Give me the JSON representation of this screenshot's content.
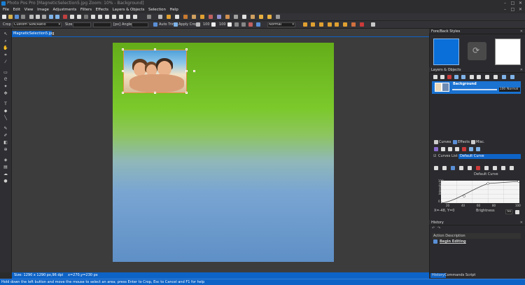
{
  "window": {
    "title": "Photo Pos Pro [MagneticSelection5.jpg Zoom: 10% - Background]",
    "controls": [
      "–",
      "□",
      "✕"
    ]
  },
  "menu": [
    "File",
    "Edit",
    "View",
    "Image",
    "Adjustments",
    "Filters",
    "Effects",
    "Layers & Objects",
    "Selection",
    "Help"
  ],
  "toolbar1": {
    "auto_trim": "Auto Trim",
    "apply_crop": "Apply Crop",
    "zoom_value_1": "100",
    "zoom_value_2": "100",
    "blend": "Normal"
  },
  "toolbar2": {
    "crop_label": "Crop",
    "crop_mode": "Custom Size/Ratio",
    "size_label": "Size",
    "px_label": "[px]",
    "angle_label": "Angle"
  },
  "document": {
    "tab": "MagneticSelection5.jpg"
  },
  "status": {
    "size": "Size: 1290 x 1290 px,96 dpi",
    "coords": "x=270,y=230 px",
    "hint": "Hold down the left button and move the mouse to select an area; press Enter to Crop, Esc to Cancel and F1 for help"
  },
  "panels": {
    "fore_back": "Fore/Back Styles",
    "layers": "Layers & Objects",
    "layer_name": "Background",
    "layer_opacity": "100",
    "layer_blend": "Normal",
    "tabs": [
      "Curves",
      "Effects",
      "Misc."
    ],
    "curves_list": "Curves List",
    "curves_selected": "Default Curve",
    "curve_title": "Default Curve",
    "curve_xlabel": "Brightness",
    "curve_ylabel": "Intensity",
    "curve_readout": "X=-48, Y=0",
    "curve_value": "50",
    "curve_xticks": [
      "0",
      "20",
      "40",
      "60",
      "80",
      "100"
    ],
    "curve_yticks": [
      "100",
      "80",
      "60",
      "40",
      "20",
      "0"
    ],
    "history": "History",
    "action_desc": "Action Description",
    "history_item": "Begin Editing",
    "bottom_tabs": [
      "History",
      "Commands Script"
    ]
  },
  "colors": {
    "accent": "#0e63c6",
    "foreground": "#0a6fd8",
    "background": "#ffffff"
  }
}
